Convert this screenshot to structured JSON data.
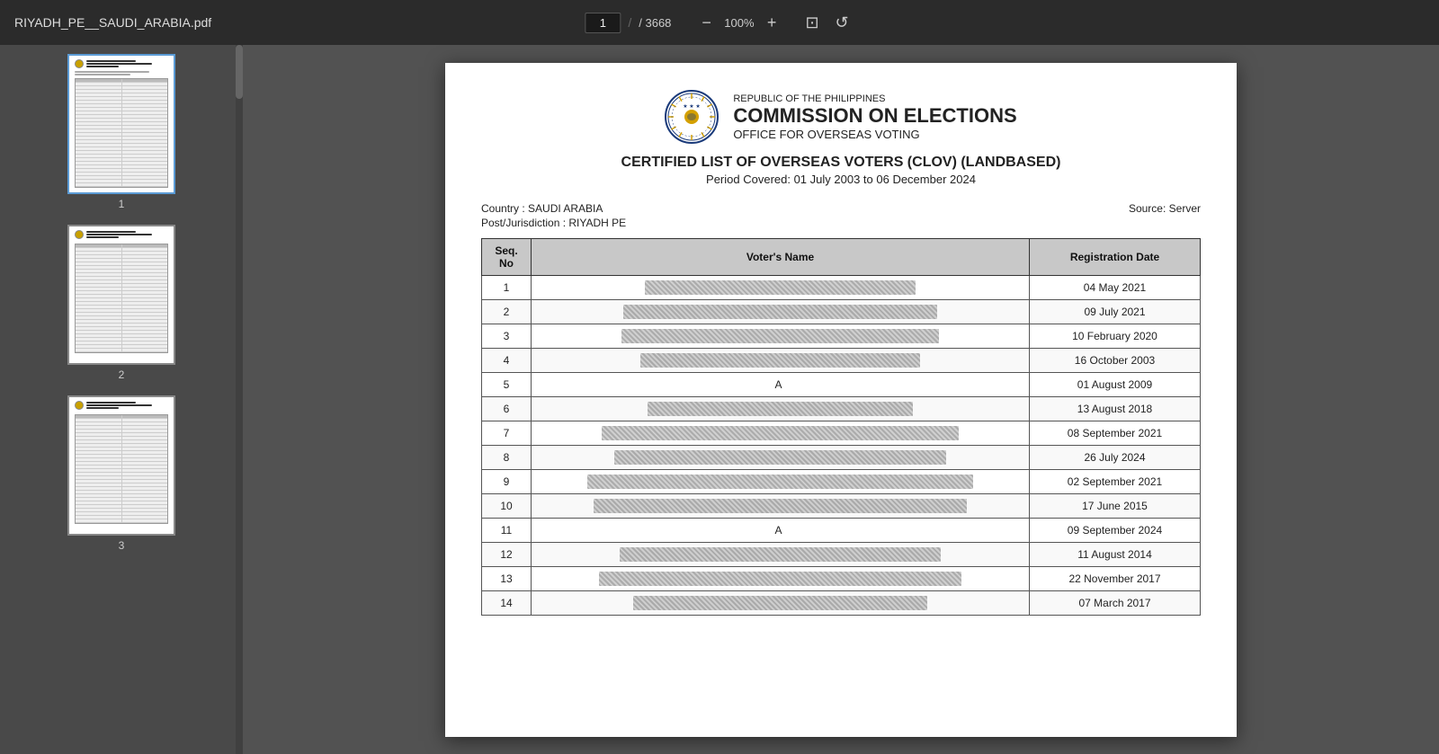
{
  "toolbar": {
    "filename": "RIYADH_PE__SAUDI_ARABIA.pdf",
    "current_page": "1",
    "total_pages": "/ 3668",
    "zoom": "100%",
    "zoom_out_label": "−",
    "zoom_in_label": "+",
    "fit_label": "⊡",
    "rotate_label": "↺"
  },
  "sidebar": {
    "pages": [
      {
        "number": "1",
        "active": true
      },
      {
        "number": "2",
        "active": false
      },
      {
        "number": "3",
        "active": false
      }
    ]
  },
  "document": {
    "republic": "REPUBLIC OF THE PHILIPPINES",
    "commission": "COMMISSION ON ELECTIONS",
    "office": "OFFICE FOR OVERSEAS VOTING",
    "clov_title": "CERTIFIED LIST OF OVERSEAS VOTERS (CLOV) (LANDBASED)",
    "period": "Period Covered: 01 July 2003 to 06 December 2024",
    "country": "Country : SAUDI ARABIA",
    "jurisdiction": "Post/Jurisdiction : RIYADH PE",
    "source": "Source: Server",
    "table": {
      "col_seq": "Seq. No",
      "col_name": "Voter's Name",
      "col_date": "Registration Date",
      "rows": [
        {
          "seq": "1",
          "date": "04 May 2021"
        },
        {
          "seq": "2",
          "date": "09 July 2021"
        },
        {
          "seq": "3",
          "date": "10 February 2020"
        },
        {
          "seq": "4",
          "date": "16 October 2003"
        },
        {
          "seq": "5",
          "date": "01 August 2009",
          "partial": "A"
        },
        {
          "seq": "6",
          "date": "13 August 2018"
        },
        {
          "seq": "7",
          "date": "08 September 2021"
        },
        {
          "seq": "8",
          "date": "26 July 2024"
        },
        {
          "seq": "9",
          "date": "02 September 2021"
        },
        {
          "seq": "10",
          "date": "17 June 2015"
        },
        {
          "seq": "11",
          "date": "09 September 2024",
          "partial": "A"
        },
        {
          "seq": "12",
          "date": "11 August 2014"
        },
        {
          "seq": "13",
          "date": "22 November 2017"
        },
        {
          "seq": "14",
          "date": "07 March 2017"
        }
      ]
    }
  }
}
